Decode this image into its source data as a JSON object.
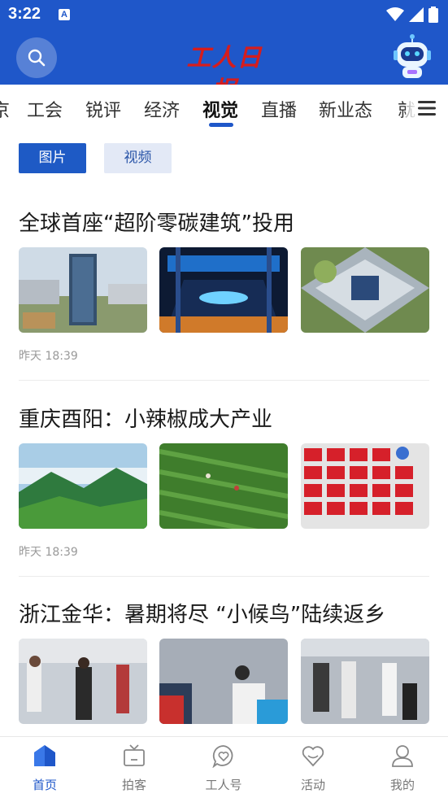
{
  "status": {
    "time": "3:22",
    "notification_icon": "a-icon"
  },
  "header": {
    "logo_text": "工人日报",
    "search_icon": "search-icon",
    "assistant_icon": "robot-icon"
  },
  "tabs": [
    {
      "label": "京",
      "active": false
    },
    {
      "label": "工会",
      "active": false
    },
    {
      "label": "锐评",
      "active": false
    },
    {
      "label": "经济",
      "active": false
    },
    {
      "label": "视觉",
      "active": true
    },
    {
      "label": "直播",
      "active": false
    },
    {
      "label": "新业态",
      "active": false
    },
    {
      "label": "就",
      "active": false
    }
  ],
  "filters": {
    "pictures": "图片",
    "videos": "视频"
  },
  "articles": [
    {
      "title": "全球首座“超阶零碳建筑”投用",
      "time": "昨天 18:39"
    },
    {
      "title": "重庆酉阳：小辣椒成大产业",
      "time": "昨天 18:39"
    },
    {
      "title": "浙江金华：暑期将尽 “小候鸟”陆续返乡",
      "time": ""
    }
  ],
  "bottom_nav": [
    {
      "label": "首页",
      "icon": "home-icon",
      "active": true
    },
    {
      "label": "拍客",
      "icon": "tv-icon",
      "active": false
    },
    {
      "label": "工人号",
      "icon": "heart-bubble-icon",
      "active": false
    },
    {
      "label": "活动",
      "icon": "heart-icon",
      "active": false
    },
    {
      "label": "我的",
      "icon": "user-icon",
      "active": false
    }
  ],
  "colors": {
    "brand_blue": "#1f57c9",
    "logo_red": "#d61d1d"
  }
}
